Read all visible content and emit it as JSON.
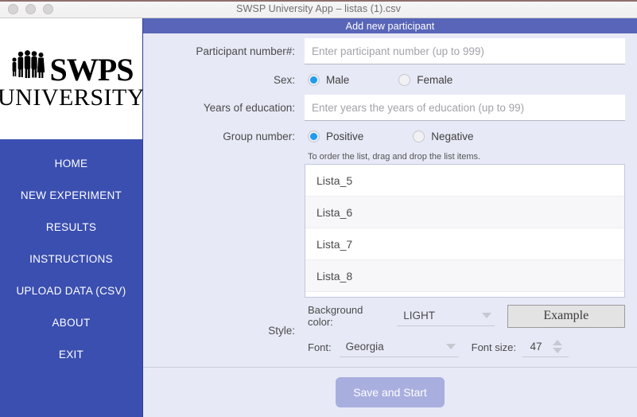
{
  "window": {
    "title": "SWSP University App – listas (1).csv",
    "traffic_lights": [
      "close-button",
      "minimize-button",
      "maximize-button"
    ]
  },
  "sidebar": {
    "logo": {
      "word": "SWPS",
      "sub": "UNIVERSITY",
      "icon": "people-silhouette-icon"
    },
    "items": [
      {
        "label": "HOME"
      },
      {
        "label": "NEW EXPERIMENT"
      },
      {
        "label": "RESULTS"
      },
      {
        "label": "INSTRUCTIONS"
      },
      {
        "label": "UPLOAD DATA (CSV)"
      },
      {
        "label": "ABOUT"
      },
      {
        "label": "EXIT"
      }
    ]
  },
  "panel": {
    "header": "Add new participant",
    "fields": {
      "participant_label": "Participant number#:",
      "participant_placeholder": "Enter participant number (up to 999)",
      "participant_value": "",
      "sex_label": "Sex:",
      "sex_options": [
        "Male",
        "Female"
      ],
      "sex_selected": "Male",
      "education_label": "Years of education:",
      "education_placeholder": "Enter years the years of education (up to 99)",
      "education_value": "",
      "group_label": "Group number:",
      "group_options": [
        "Positive",
        "Negative"
      ],
      "group_selected": "Positive"
    },
    "list": {
      "hint": "To order the list, drag and drop the list items.",
      "items": [
        "Lista_5",
        "Lista_6",
        "Lista_7",
        "Lista_8"
      ]
    },
    "style": {
      "label": "Style:",
      "background_color_label": "Background color:",
      "background_color_value": "LIGHT",
      "example_button": "Example",
      "font_label": "Font:",
      "font_value": "Georgia",
      "font_size_label": "Font size:",
      "font_size_value": "47"
    },
    "footer": {
      "save_label": "Save and Start"
    }
  },
  "colors": {
    "sidebar": "#3b4fb0",
    "header": "#5865b8",
    "panel_bg": "#e7e9f6",
    "radio_on": "#1e9bf0",
    "save_button": "#a8aede"
  }
}
